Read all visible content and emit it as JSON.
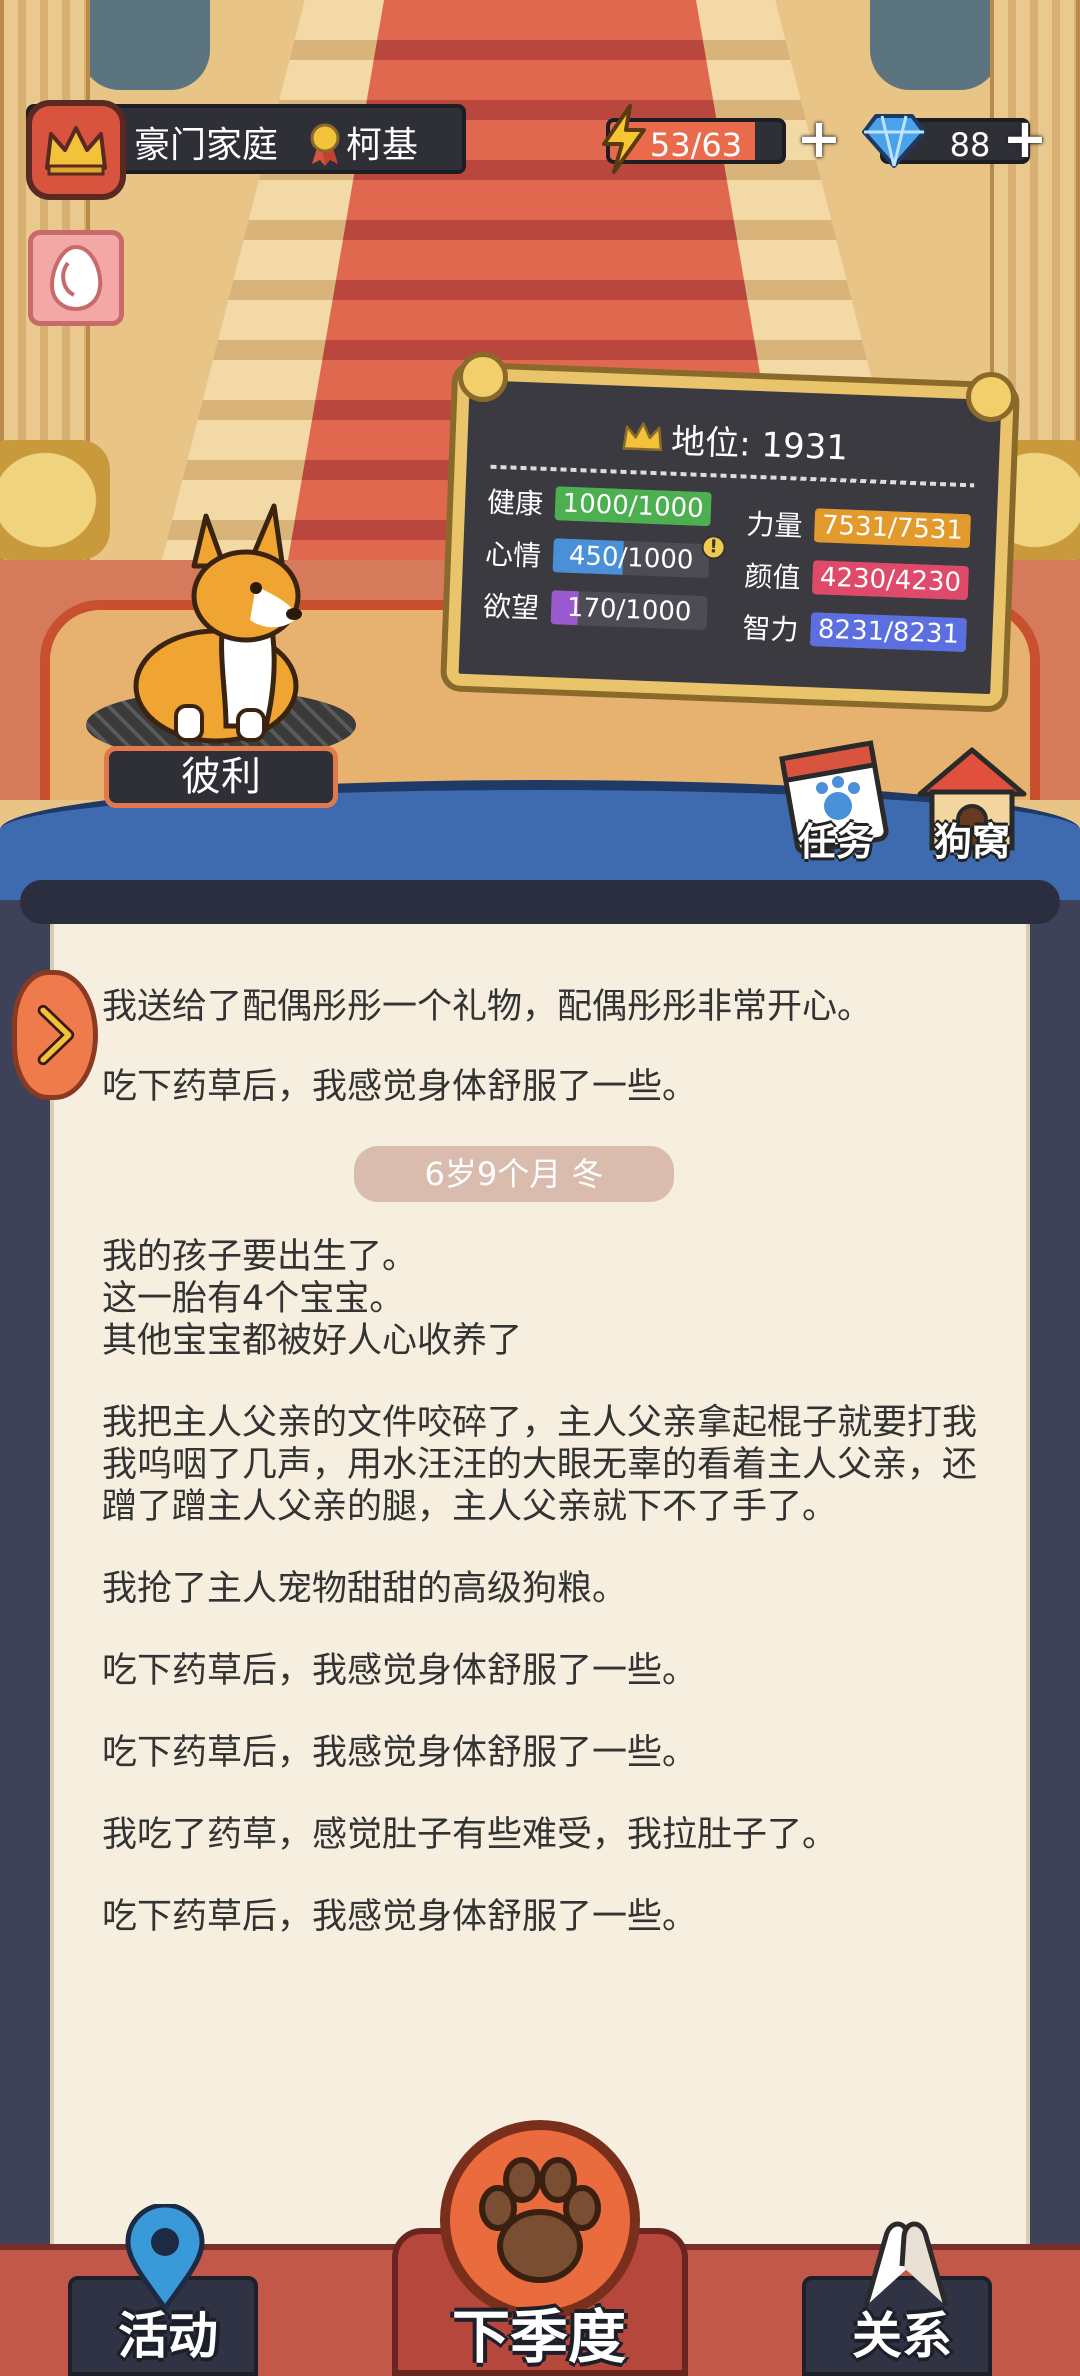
{
  "header": {
    "family_title": "豪门家庭",
    "dog_breed": "柯基",
    "energy": {
      "text": "53/63",
      "current": 53,
      "max": 63
    },
    "gems": "88"
  },
  "dog": {
    "name": "彼利"
  },
  "status_board": {
    "status_label": "地位: 1931",
    "stats": [
      {
        "label": "健康",
        "value": "1000/1000",
        "fraction": 1.0,
        "color": "#4caf50"
      },
      {
        "label": "力量",
        "value": "7531/7531",
        "fraction": 1.0,
        "color": "#e39a2c"
      },
      {
        "label": "心情",
        "value": "450/1000",
        "fraction": 0.45,
        "color": "#4a90d9"
      },
      {
        "label": "颜值",
        "value": "4230/4230",
        "fraction": 1.0,
        "color": "#e04a6a"
      },
      {
        "label": "欲望",
        "value": "170/1000",
        "fraction": 0.17,
        "color": "#9b59d0"
      },
      {
        "label": "智力",
        "value": "8231/8231",
        "fraction": 1.0,
        "color": "#5b6fe0"
      }
    ]
  },
  "side_buttons": {
    "task": "任务",
    "kennel": "狗窝"
  },
  "log": {
    "entries_before": [
      "我送给了配偶彤彤一个礼物，配偶彤彤非常开心。",
      "吃下药草后，我感觉身体舒服了一些。"
    ],
    "season": "6岁9个月 冬",
    "entries_after": [
      "我的孩子要出生了。\n这一胎有4个宝宝。\n其他宝宝都被好人心收养了",
      "我把主人父亲的文件咬碎了，主人父亲拿起棍子就要打我\n我呜咽了几声，用水汪汪的大眼无辜的看着主人父亲，还蹭了蹭主人父亲的腿，主人父亲就下不了手了。",
      "我抢了主人宠物甜甜的高级狗粮。",
      "吃下药草后，我感觉身体舒服了一些。",
      "吃下药草后，我感觉身体舒服了一些。",
      "我吃了药草，感觉肚子有些难受，我拉肚子了。",
      "吃下药草后，我感觉身体舒服了一些。"
    ]
  },
  "bottom_nav": {
    "activity": "活动",
    "next_season": "下季度",
    "relations": "关系"
  }
}
